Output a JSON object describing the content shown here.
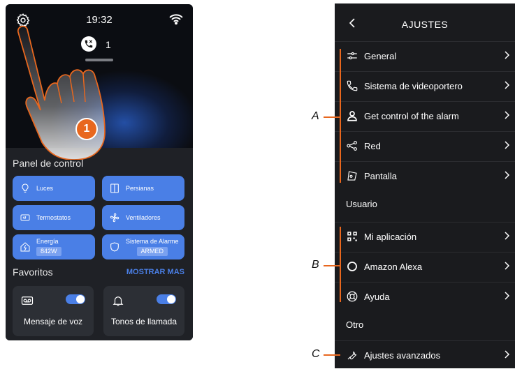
{
  "device": {
    "time": "19:32",
    "missed_calls": "1",
    "marker": "1",
    "panel_title": "Panel de control",
    "tiles": [
      {
        "label": "Luces"
      },
      {
        "label": "Persianas"
      },
      {
        "label": "Termostatos"
      },
      {
        "label": "Ventiladores"
      },
      {
        "label": "Energía",
        "value": "842W"
      },
      {
        "label": "Sistema de Alarme",
        "value": "ARMED"
      }
    ],
    "favorites_title": "Favoritos",
    "show_more": "MOSTRAR MAS",
    "favorites": [
      {
        "label": "Mensaje de voz"
      },
      {
        "label": "Tonos de llamada"
      }
    ],
    "accent": "#4a7fe6"
  },
  "settings": {
    "title": "AJUSTES",
    "groupA": [
      {
        "label": "General"
      },
      {
        "label": "Sistema de videoportero"
      },
      {
        "label": "Get control of the alarm"
      },
      {
        "label": "Red"
      },
      {
        "label": "Pantalla"
      }
    ],
    "user_section": "Usuario",
    "groupB": [
      {
        "label": "Mi aplicación"
      },
      {
        "label": "Amazon Alexa"
      },
      {
        "label": "Ayuda"
      }
    ],
    "other_section": "Otro",
    "groupC": [
      {
        "label": "Ajustes avanzados"
      }
    ]
  },
  "callouts": {
    "a": "A",
    "b": "B",
    "c": "C"
  },
  "colors": {
    "callout": "#e8671e"
  }
}
